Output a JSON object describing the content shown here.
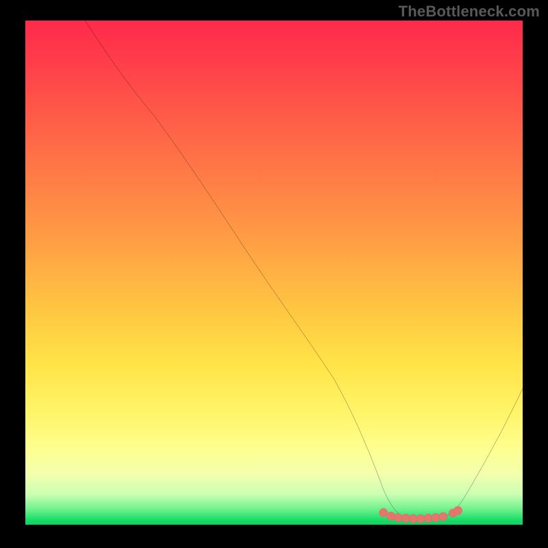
{
  "watermark": "TheBottleneck.com",
  "chart_data": {
    "type": "line",
    "title": "",
    "xlabel": "",
    "ylabel": "",
    "xlim": [
      0,
      100
    ],
    "ylim": [
      0,
      100
    ],
    "grid": false,
    "legend": false,
    "trough_x_range": [
      72,
      86
    ],
    "series": [
      {
        "name": "curve",
        "x": [
          12,
          18,
          26,
          35,
          44,
          53,
          62,
          70,
          73,
          76,
          79,
          82,
          85,
          88,
          92,
          96,
          100
        ],
        "y": [
          100,
          92,
          81,
          68,
          55,
          42,
          29,
          13,
          4,
          1.3,
          1.0,
          1.0,
          1.2,
          3,
          9,
          17,
          27
        ]
      }
    ],
    "markers": {
      "name": "trough-markers",
      "color": "#e3766f",
      "x": [
        72,
        73.5,
        75,
        76.5,
        78,
        79.5,
        81,
        82.5,
        84,
        86,
        87
      ],
      "y": [
        2.4,
        1.7,
        1.4,
        1.3,
        1.2,
        1.2,
        1.3,
        1.4,
        1.6,
        2.3,
        2.8
      ]
    }
  }
}
